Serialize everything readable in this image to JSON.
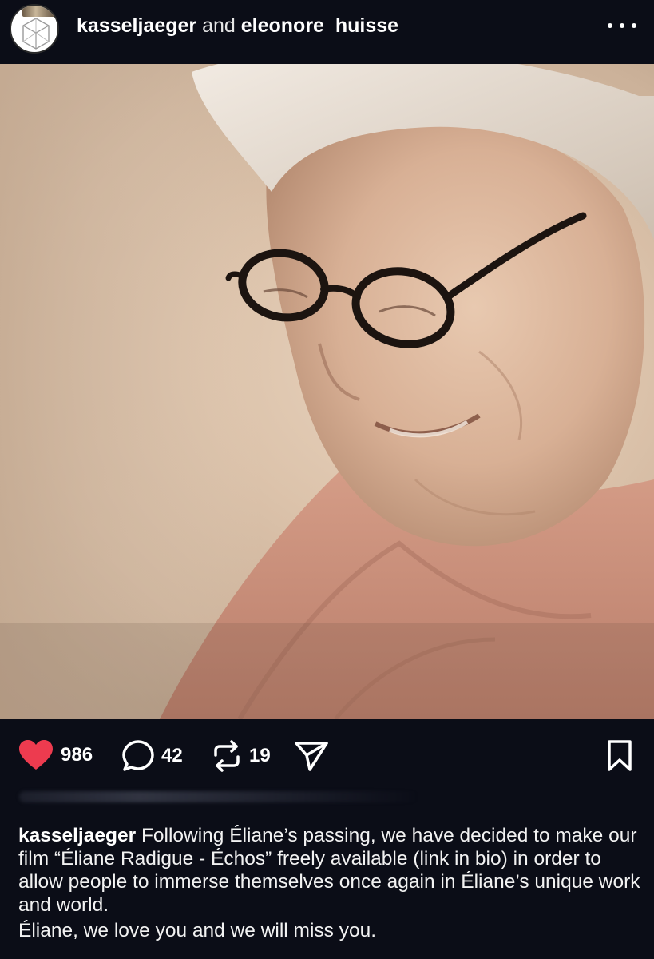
{
  "post": {
    "author": "kasseljaeger",
    "conjunction": "and",
    "collaborator": "eleonore_huisse",
    "avatar_icon": "hexagon-logo-icon",
    "more_icon": "more-options-icon"
  },
  "photo": {
    "alt": "photo",
    "tones": {
      "light": "#e9d4bf",
      "mid": "#cbb199",
      "scarf": "#d49a86",
      "dark": "#1c1410"
    }
  },
  "actions": {
    "likes": "986",
    "comments": "42",
    "reposts": "19",
    "like_color": "#ed3b4f"
  },
  "caption": {
    "author": "kasseljaeger",
    "text": "Following Éliane’s passing, we have decided to make our film “Éliane Radigue - Échos” freely available (link in bio) in order to allow people to immerse themselves once again in Éliane’s unique work and world.",
    "second_line": "Éliane, we love you and we will miss you."
  }
}
